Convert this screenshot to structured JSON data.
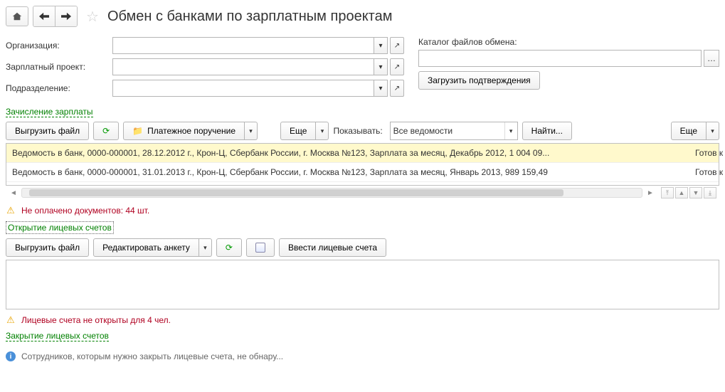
{
  "header": {
    "title": "Обмен с банками по зарплатным проектам"
  },
  "filters": {
    "org_label": "Организация:",
    "project_label": "Зарплатный проект:",
    "dept_label": "Подразделение:",
    "org_value": "",
    "project_value": "",
    "dept_value": "",
    "catalog_label": "Каталог файлов обмена:",
    "catalog_value": "",
    "load_btn": "Загрузить подтверждения"
  },
  "section1_link": "Зачисление зарплаты",
  "toolbar1": {
    "export_btn": "Выгрузить файл",
    "pay_order_btn": "Платежное поручение",
    "more_btn": "Еще",
    "show_label": "Показывать:",
    "show_value": "Все ведомости",
    "find_btn": "Найти...",
    "more2_btn": "Еще"
  },
  "list1": [
    {
      "text": "Ведомость в банк, 0000-000001, 28.12.2012 г., Крон-Ц, Сбербанк России, г. Москва №123, Зарплата за месяц, Декабрь 2012, 1 004 09...",
      "status": "Готов к выгрузке"
    },
    {
      "text": "Ведомость в банк, 0000-000001, 31.01.2013 г., Крон-Ц, Сбербанк России, г. Москва №123, Зарплата за месяц, Январь 2013, 989 159,49",
      "status": "Готов к выгрузке"
    }
  ],
  "warning1": "Не оплачено документов: 44 шт.",
  "section2_link": "Открытие лицевых счетов",
  "toolbar2": {
    "export_btn": "Выгрузить файл",
    "edit_btn": "Редактировать анкету",
    "enter_btn": "Ввести лицевые счета"
  },
  "warning2": "Лицевые счета не открыты для 4 чел.",
  "section3_link": "Закрытие лицевых счетов",
  "info3": "Сотрудников, которым нужно закрыть лицевые счета, не обнару..."
}
